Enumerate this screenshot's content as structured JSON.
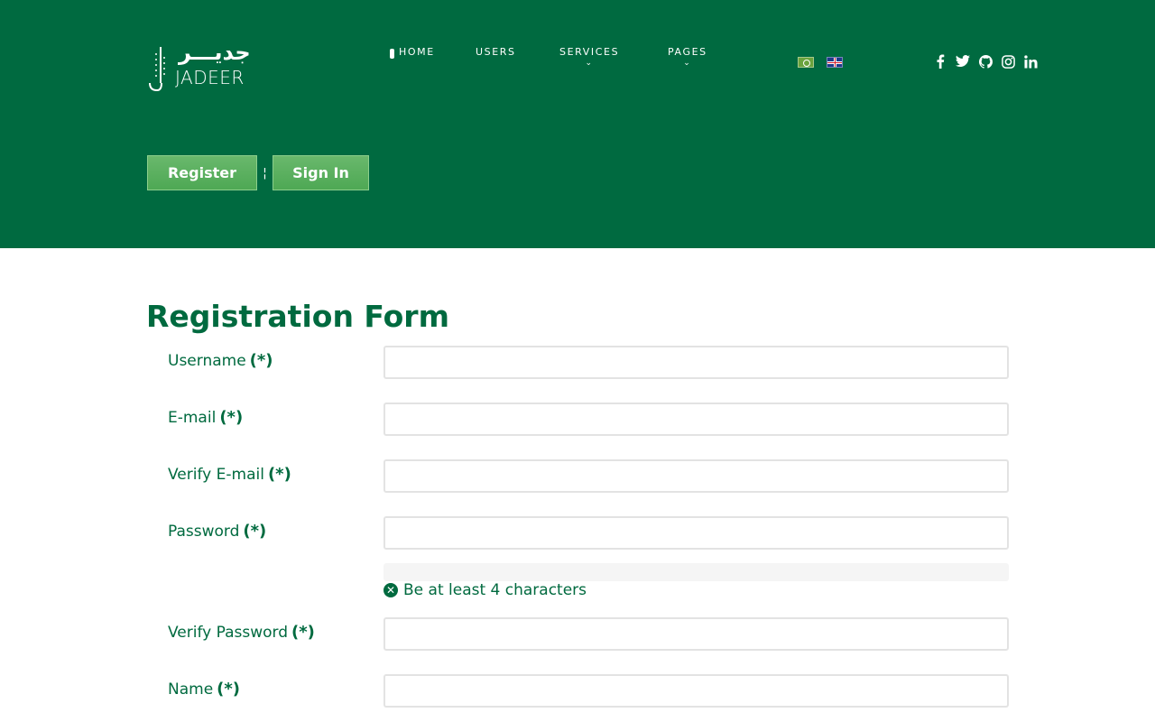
{
  "brand": {
    "arabic": "جديـــر",
    "name": "JADEER"
  },
  "nav": {
    "home": "HOME",
    "users": "USERS",
    "services": "SERVICES",
    "pages": "PAGES",
    "chevron": "⌄"
  },
  "languages": [
    "ar-flag-icon",
    "en-flag-icon"
  ],
  "social": {
    "facebook": "f",
    "twitter": "t",
    "github": "g",
    "instagram": "i",
    "linkedin": "in"
  },
  "auth": {
    "register": "Register",
    "separator": "¦",
    "signin": "Sign In"
  },
  "form": {
    "title": "Registration Form",
    "required_mark": "(*)",
    "fields": [
      {
        "label": "Username",
        "value": ""
      },
      {
        "label": "E-mail",
        "value": ""
      },
      {
        "label": "Verify E-mail",
        "value": ""
      },
      {
        "label": "Password",
        "value": ""
      },
      {
        "label": "Verify Password",
        "value": ""
      },
      {
        "label": "Name",
        "value": ""
      }
    ],
    "password_hint": "Be at least 4 characters",
    "hint_icon": "✕"
  },
  "colors": {
    "primary": "#006a40",
    "button": "#5cb25f"
  }
}
